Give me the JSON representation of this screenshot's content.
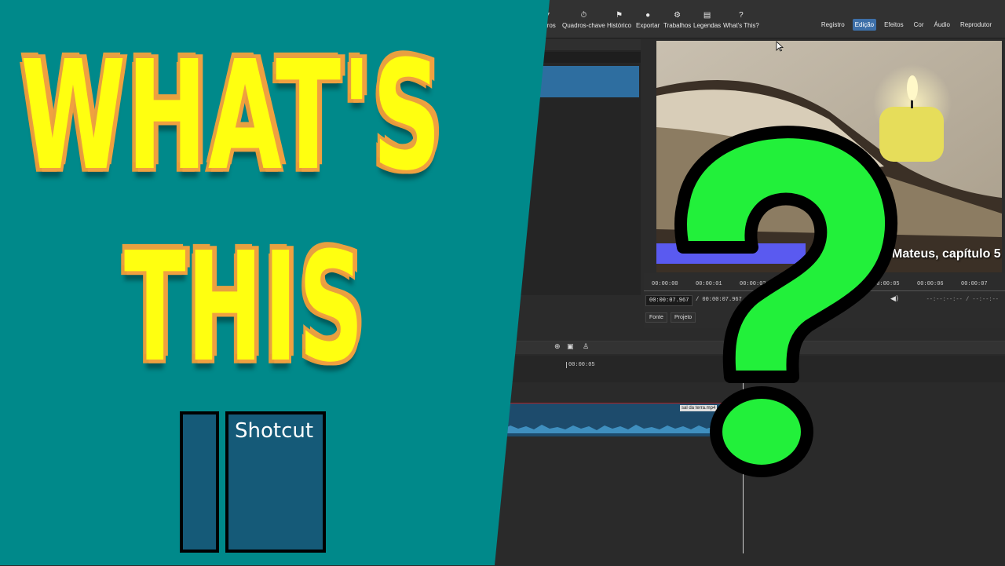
{
  "toolbar": {
    "buttons": [
      {
        "label": "Filtros",
        "icon": "filter-icon"
      },
      {
        "label": "Quadros-chave",
        "icon": "stopwatch-icon"
      },
      {
        "label": "Histórico",
        "icon": "history-icon"
      },
      {
        "label": "Exportar",
        "icon": "export-icon"
      },
      {
        "label": "Trabalhos",
        "icon": "gear-icon"
      },
      {
        "label": "Legendas",
        "icon": "subtitles-icon"
      },
      {
        "label": "What's This?",
        "icon": "question-icon"
      }
    ],
    "layouts": [
      "Registro",
      "Edição",
      "Efeitos",
      "Cor",
      "Áudio",
      "Reprodutor"
    ],
    "active_layout": "Edição"
  },
  "player": {
    "subtitle_text": "Mateus, capítulo 5",
    "ruler_ticks": [
      "00:00:00",
      "00:00:01",
      "00:00:02",
      "00:00:05",
      "00:00:06",
      "00:00:07"
    ],
    "current_timecode": "00:00:07.967",
    "total_timecode": "/ 00:00:07.967",
    "in_out": "--:--:--:-- / --:--:--",
    "tabs": [
      "Fonte",
      "Projeto"
    ]
  },
  "timeline": {
    "ruler_label": "00:00:05",
    "clip_name": "sal da terra.mp4"
  },
  "thumbnail": {
    "title_line1": "WHAT'S",
    "title_line2": "THIS",
    "logo_text": "Shotcut"
  },
  "colors": {
    "teal": "#00898a",
    "title_yellow": "#ffff10",
    "glow_orange": "#f0a040",
    "question_green": "#22f03a",
    "logo_blue": "#155a78",
    "active_layout": "#3d6fa8"
  }
}
